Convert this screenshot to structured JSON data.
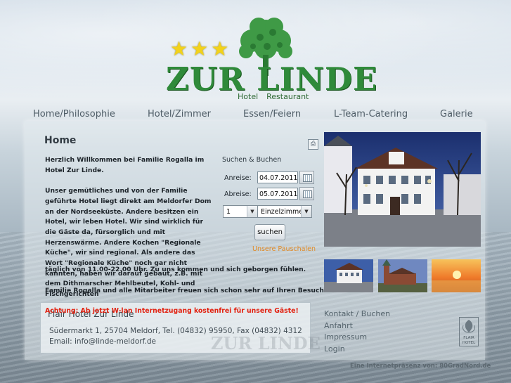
{
  "header": {
    "stars": 3,
    "title": "ZUR LINDE",
    "sub_left": "Hotel",
    "sub_right": "Restaurant"
  },
  "nav": {
    "items": [
      "Home/Philosophie",
      "Hotel/Zimmer",
      "Essen/Feiern",
      "L-Team-Catering",
      "Galerie"
    ]
  },
  "main": {
    "title": "Home",
    "intro_p1": "Herzlich Willkommen bei Familie Rogalla im Hotel Zur Linde.",
    "intro_p2": "Unser gemütliches und von der Familie geführte Hotel liegt direkt am Meldorfer Dom an der Nordseeküste. Andere besitzen ein Hotel, wir leben Hotel. Wir sind wirklich für die Gäste da, fürsorglich und mit Herzenswärme. Andere Kochen \"Regionale Küche\", wir sind regional. Als andere das Wort \"Regionale Küche\" noch gar nicht kannten, haben wir darauf gebaut, z.B. mit dem Dithmarscher Mehlbeutel, Kohl- und Fischgerichten",
    "intro_cont": "täglich von 11.00-22.00 Uhr. Zu uns kommen und sich geborgen fühlen.",
    "greeting": "Familie Rogalla und alle Mitarbeiter freuen sich schon sehr auf Ihren Besuch."
  },
  "booking": {
    "title": "Suchen & Buchen",
    "arrival_label": "Anreise:",
    "arrival_value": "04.07.2011",
    "departure_label": "Abreise:",
    "departure_value": "05.07.2011",
    "count_value": "1",
    "room_value": "Einzelzimme",
    "search_label": "suchen",
    "packages_link": "Unsere Pauschalen"
  },
  "address": {
    "warning": "Achtung: Ab jetzt W-lan Internetzugang kostenfrei für unsere Gäste!",
    "name": "Flair Hotel  Zur Linde",
    "street": "Südermarkt 1, 25704 Meldorf, Tel. (04832) 95950, Fax (04832) 4312",
    "email": "Email: info@linde-meldorf.de",
    "watermark": "ZUR LINDE"
  },
  "side_links": [
    "Kontakt / Buchen",
    "Anfahrt",
    "Impressum",
    "Login"
  ],
  "flair_logo": "FLAIR HOTEL",
  "footer": "Eine Internetpräsenz von: 80GradNord.de",
  "colors": {
    "logo_green": "#2f8a3a",
    "star_yellow": "#f2d21b",
    "warning_red": "#e2200f",
    "link_orange": "#e08a26"
  }
}
